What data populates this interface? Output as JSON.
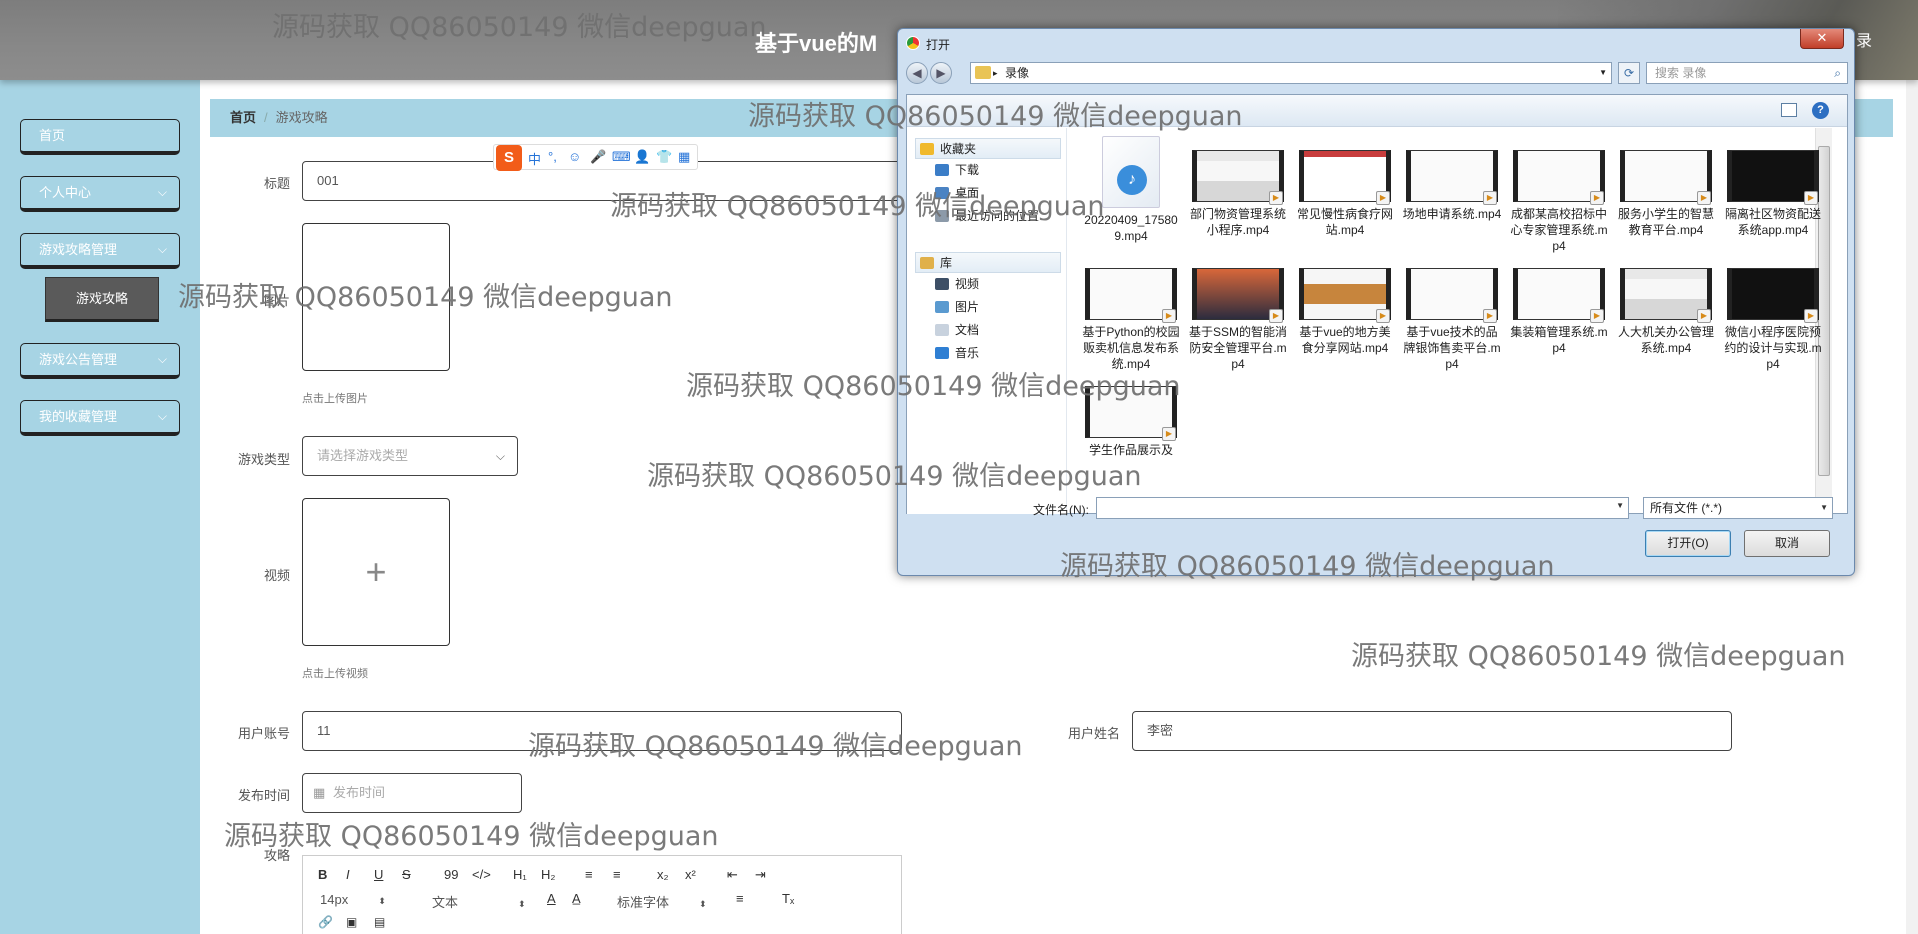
{
  "header": {
    "title": "基于vue的M",
    "logout": "录"
  },
  "sidebar": {
    "items": [
      {
        "label": "首页",
        "chevron": ""
      },
      {
        "label": "个人中心",
        "chevron": "⌵"
      },
      {
        "label": "游戏攻略管理",
        "chevron": "⌵"
      },
      {
        "label": "游戏公告管理",
        "chevron": "⌵"
      },
      {
        "label": "我的收藏管理",
        "chevron": "⌵"
      }
    ],
    "active_sub": "游戏攻略"
  },
  "breadcrumb": {
    "home": "首页",
    "sep": "/",
    "current": "游戏攻略"
  },
  "form": {
    "title_label": "标题",
    "title_value": "001",
    "image_label": "图片",
    "image_hint": "点击上传图片",
    "type_label": "游戏类型",
    "type_placeholder": "请选择游戏类型",
    "video_label": "视频",
    "video_hint": "点击上传视频",
    "account_label": "用户账号",
    "account_value": "11",
    "name_label": "用户姓名",
    "name_value": "李密",
    "time_label": "发布时间",
    "time_placeholder": "发布时间",
    "guide_label": "攻略"
  },
  "editor": {
    "row1": [
      "B",
      "I",
      "U",
      "S",
      "99",
      "</>",
      "H₁",
      "H₂",
      "≡",
      "≡",
      "x₂",
      "x²",
      "⇤",
      "⇥"
    ],
    "size": "14px",
    "block": "文本",
    "font": "标准字体",
    "row3": [
      "🔗",
      "▣",
      "▤"
    ]
  },
  "ime": {
    "logo": "S",
    "icons": [
      "中",
      "°,",
      "☺",
      "🎤",
      "⌨",
      "👤",
      "👕",
      "▦"
    ]
  },
  "dialog": {
    "title": "打开",
    "close": "✕",
    "path": "录像",
    "search_placeholder": "搜索 录像",
    "nav": [
      {
        "label": "收藏夹",
        "color": "#f0b92c",
        "section": true
      },
      {
        "label": "下载",
        "color": "#3b7dc7",
        "section": false
      },
      {
        "label": "桌面",
        "color": "#4b83c3",
        "section": false
      },
      {
        "label": "最近访问的位置",
        "color": "#8c9aa9",
        "section": false
      },
      {
        "label": "库",
        "color": "#e0b04a",
        "section": true
      },
      {
        "label": "视频",
        "color": "#3d4f66",
        "section": false
      },
      {
        "label": "图片",
        "color": "#5a9ad0",
        "section": false
      },
      {
        "label": "文档",
        "color": "#c8d2de",
        "section": false
      },
      {
        "label": "音乐",
        "color": "#2f7fd3",
        "section": false
      }
    ],
    "files": [
      {
        "name": "20220409_175809.mp4",
        "thumb": "doc"
      },
      {
        "name": "部门物资管理系统小程序.mp4",
        "thumb": "web"
      },
      {
        "name": "常见慢性病食疗网站.mp4",
        "thumb": "red"
      },
      {
        "name": "场地申请系统.mp4",
        "thumb": "blank"
      },
      {
        "name": "成都某高校招标中心专家管理系统.mp4",
        "thumb": "blank"
      },
      {
        "name": "服务小学生的智慧教育平台.mp4",
        "thumb": "blank"
      },
      {
        "name": "隔离社区物资配送系统app.mp4",
        "thumb": "dark"
      },
      {
        "name": "基于Python的校园贩卖机信息发布系统.mp4",
        "thumb": "blank"
      },
      {
        "name": "基于SSM的智能消防安全管理平台.mp4",
        "thumb": "sunset"
      },
      {
        "name": "基于vue的地方美食分享网站.mp4",
        "thumb": "food"
      },
      {
        "name": "基于vue技术的品牌银饰售卖平台.mp4",
        "thumb": "blank"
      },
      {
        "name": "集装箱管理系统.mp4",
        "thumb": "blank"
      },
      {
        "name": "人大机关办公管理系统.mp4",
        "thumb": "web"
      },
      {
        "name": "微信小程序医院预约的设计与实现.mp4",
        "thumb": "dark"
      },
      {
        "name": "学生作品展示及",
        "thumb": "blank"
      }
    ],
    "filename_label": "文件名(N):",
    "filename_value": "",
    "filetype": "所有文件 (*.*)",
    "open": "打开(O)",
    "cancel": "取消"
  },
  "watermark": "源码获取 QQ86050149 微信deepguan"
}
